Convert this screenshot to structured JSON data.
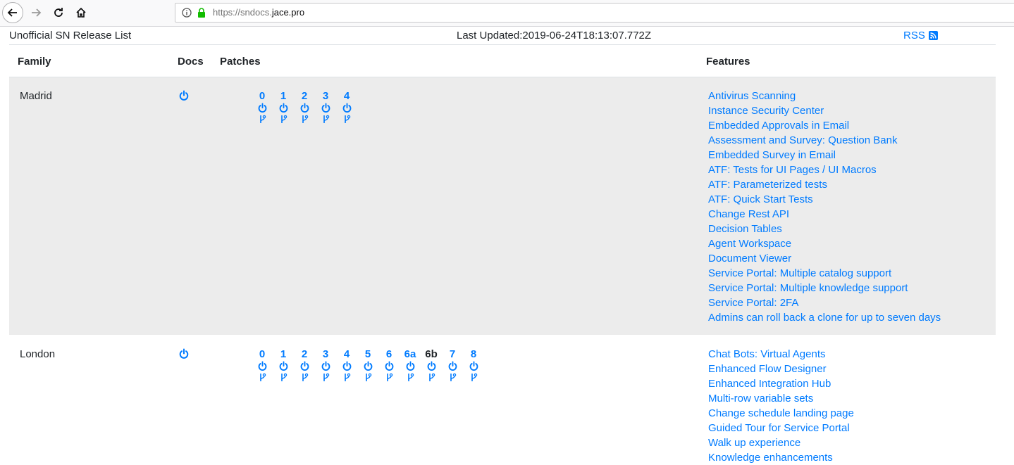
{
  "browser": {
    "url_prefix": "https://sndocs.",
    "url_domain": "jace.pro"
  },
  "page": {
    "brand": "Unofficial SN Release List",
    "last_updated": "Last Updated:2019-06-24T18:13:07.772Z",
    "rss_label": "RSS"
  },
  "table": {
    "headers": {
      "family": "Family",
      "docs": "Docs",
      "patches": "Patches",
      "features": "Features"
    }
  },
  "releases": [
    {
      "family": "Madrid",
      "patches": [
        "0",
        "1",
        "2",
        "3",
        "4"
      ],
      "features": [
        "Antivirus Scanning",
        "Instance Security Center",
        "Embedded Approvals in Email",
        "Assessment and Survey: Question Bank",
        "Embedded Survey in Email",
        "ATF: Tests for UI Pages / UI Macros",
        "ATF: Parameterized tests",
        "ATF: Quick Start Tests",
        "Change Rest API",
        "Decision Tables",
        "Agent Workspace",
        "Document Viewer",
        "Service Portal: Multiple catalog support",
        "Service Portal: Multiple knowledge support",
        "Service Portal: 2FA",
        "Admins can roll back a clone for up to seven days"
      ]
    },
    {
      "family": "London",
      "patches": [
        "0",
        "1",
        "2",
        "3",
        "4",
        "5",
        "6",
        "6a",
        "6b",
        "7",
        "8"
      ],
      "current_patch": "6b",
      "features": [
        "Chat Bots: Virtual Agents",
        "Enhanced Flow Designer",
        "Enhanced Integration Hub",
        "Multi-row variable sets",
        "Change schedule landing page",
        "Guided Tour for Service Portal",
        "Walk up experience",
        "Knowledge enhancements"
      ]
    }
  ],
  "icons": {
    "docs": "power-icon",
    "patch_docs": "power-icon",
    "patch_branch": "branch-icon",
    "rss": "rss-icon"
  },
  "colors": {
    "link": "#007bff",
    "row_shade": "#ececec",
    "secure": "#12bc00"
  }
}
